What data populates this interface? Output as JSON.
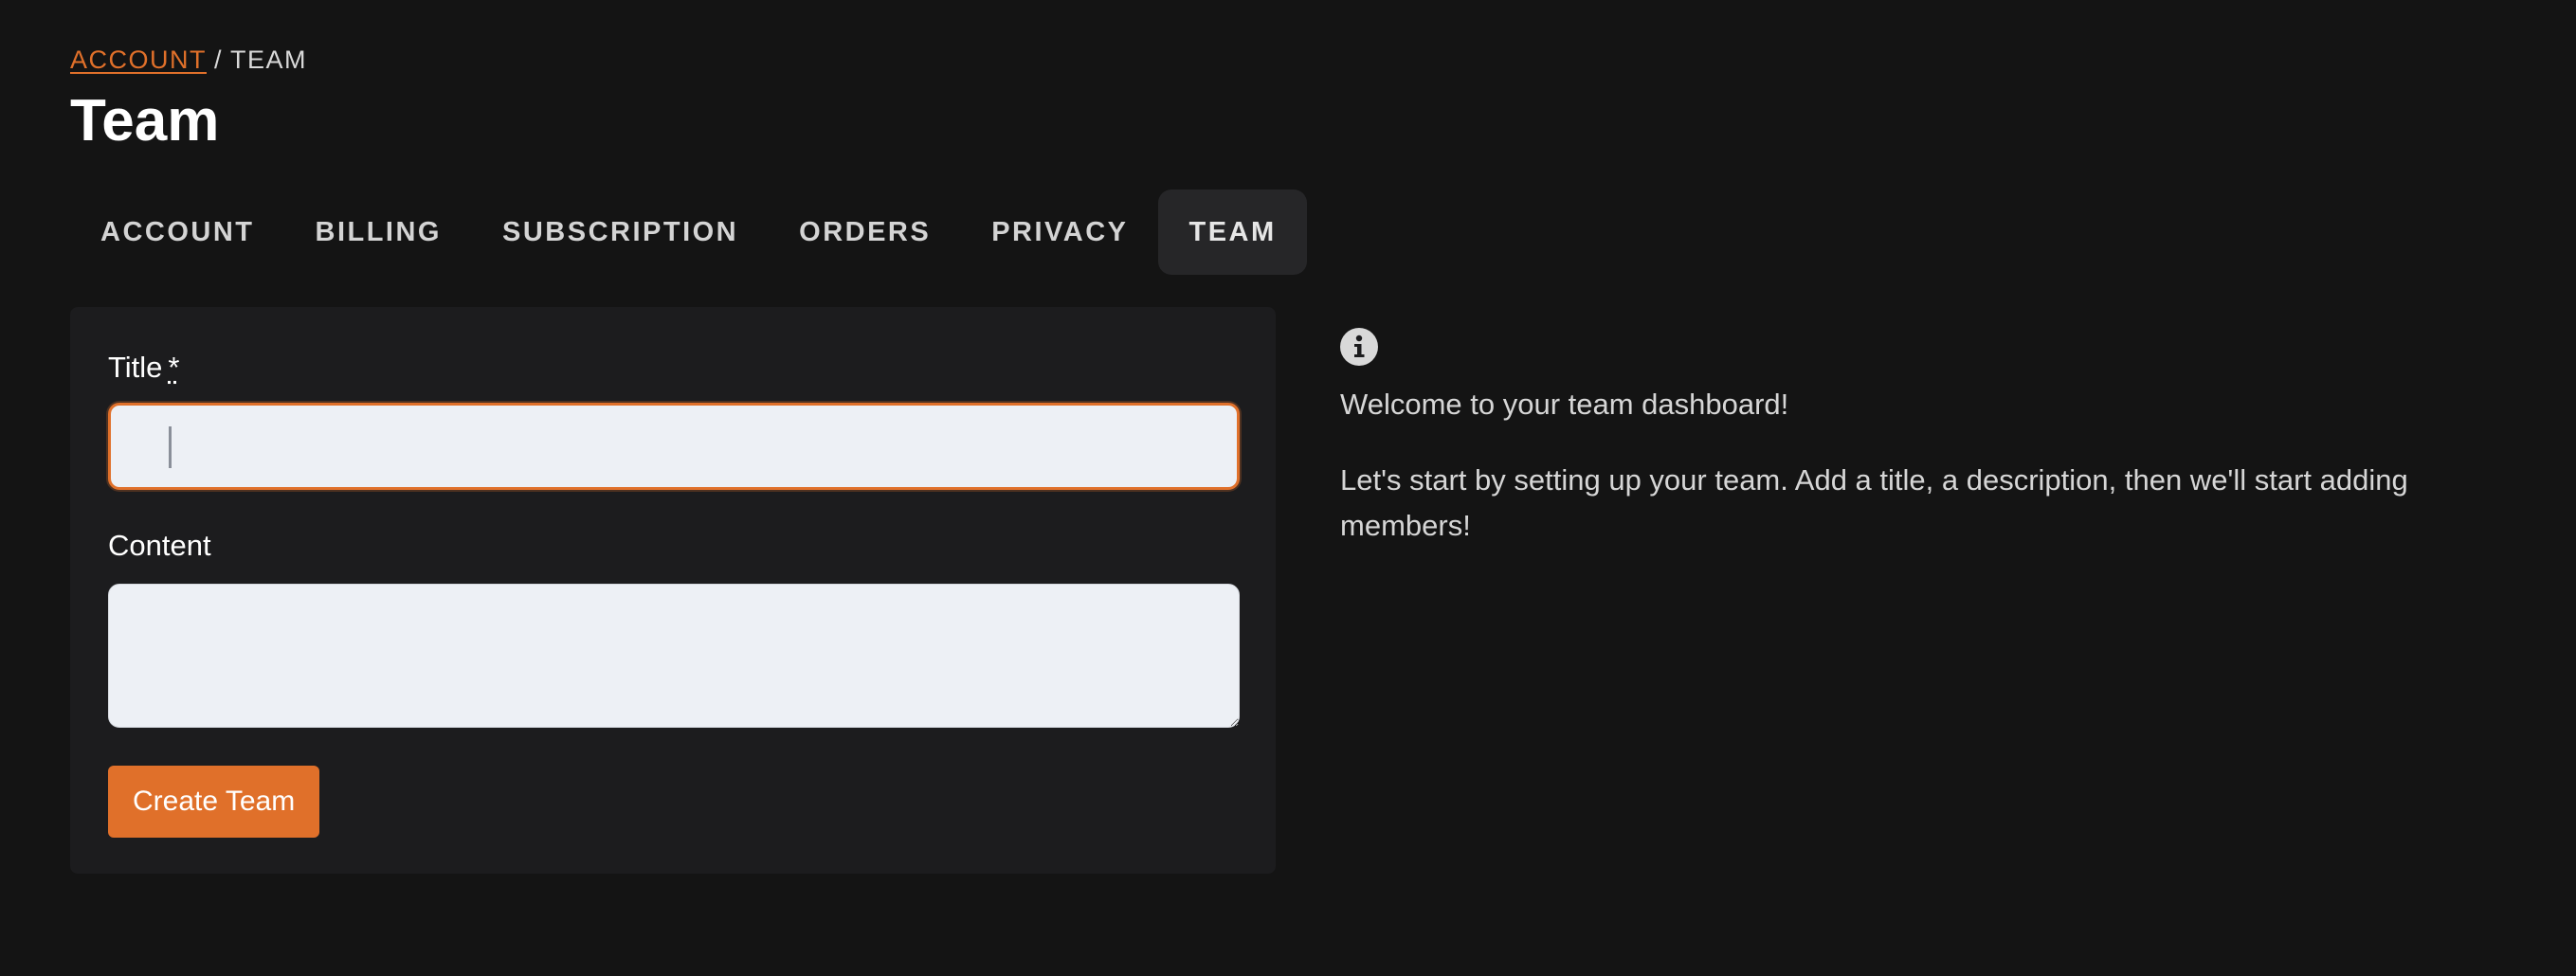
{
  "breadcrumb": {
    "parent": "ACCOUNT",
    "separator": "/",
    "current": "TEAM"
  },
  "page_title": "Team",
  "tabs": [
    {
      "label": "ACCOUNT",
      "active": false
    },
    {
      "label": "BILLING",
      "active": false
    },
    {
      "label": "SUBSCRIPTION",
      "active": false
    },
    {
      "label": "ORDERS",
      "active": false
    },
    {
      "label": "PRIVACY",
      "active": false
    },
    {
      "label": "TEAM",
      "active": true
    }
  ],
  "form": {
    "title_label": "Title",
    "title_required_mark": "*",
    "title_value": "",
    "content_label": "Content",
    "content_value": "",
    "submit_label": "Create Team"
  },
  "info": {
    "icon": "info-circle-icon",
    "welcome": "Welcome to your team dashboard!",
    "body": "Let's start by setting up your team. Add a title, a description, then we'll start adding members!"
  },
  "colors": {
    "background": "#141414",
    "card": "#1c1c1e",
    "accent": "#e0702a",
    "input_bg": "#edf0f5",
    "active_tab_bg": "#262628"
  }
}
